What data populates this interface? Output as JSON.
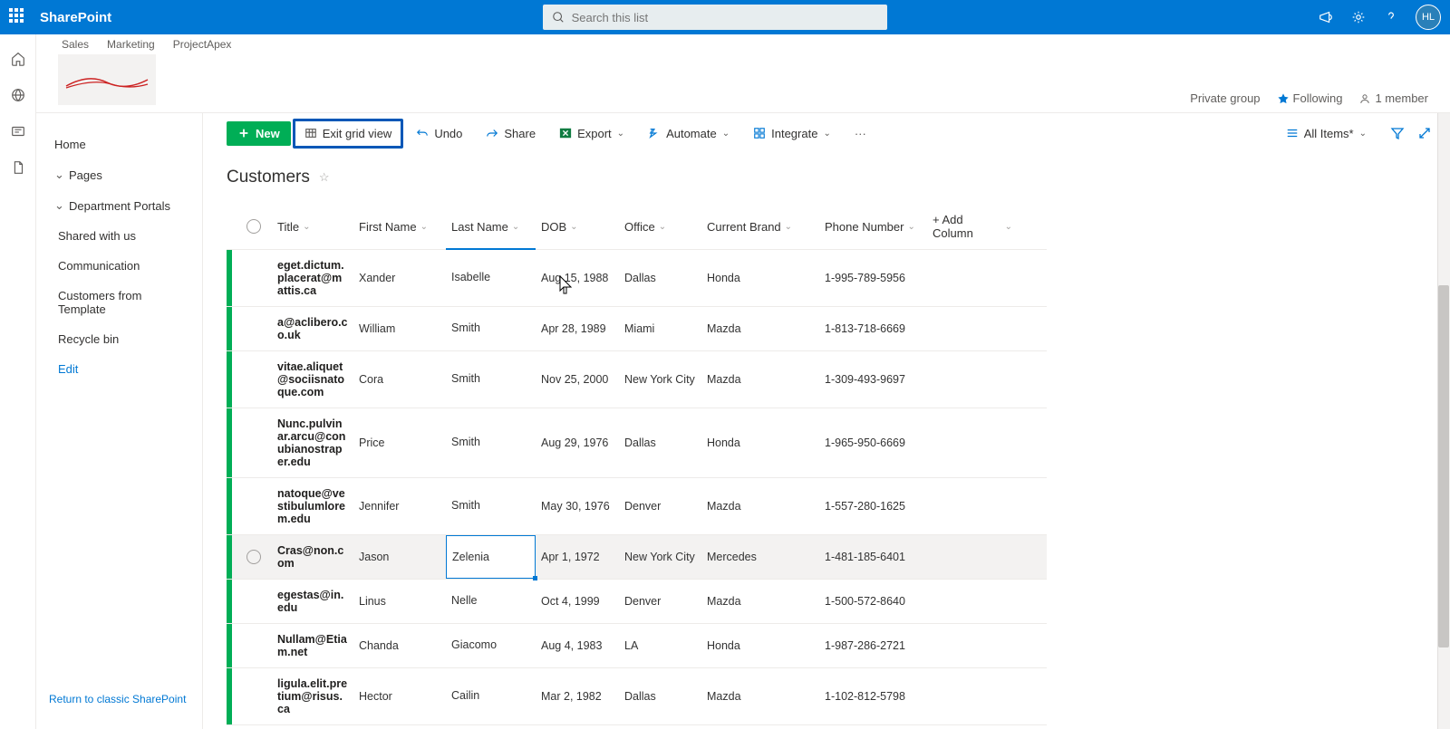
{
  "suite": {
    "brand": "SharePoint",
    "search_placeholder": "Search this list",
    "avatar": "HL"
  },
  "hub_nav": [
    "Sales",
    "Marketing",
    "ProjectApex"
  ],
  "site_right": {
    "group": "Private group",
    "following": "Following",
    "members": "1 member"
  },
  "left_nav": {
    "home": "Home",
    "pages": "Pages",
    "dept": "Department Portals",
    "shared": "Shared with us",
    "comm": "Communication",
    "cust": "Customers from Template",
    "recycle": "Recycle bin",
    "edit": "Edit",
    "return": "Return to classic SharePoint"
  },
  "cmd": {
    "new": "New",
    "exit": "Exit grid view",
    "undo": "Undo",
    "share": "Share",
    "export": "Export",
    "automate": "Automate",
    "integrate": "Integrate",
    "view": "All Items*"
  },
  "list": {
    "title": "Customers"
  },
  "columns": {
    "title": "Title",
    "first": "First Name",
    "last": "Last Name",
    "dob": "DOB",
    "office": "Office",
    "brand": "Current Brand",
    "phone": "Phone Number",
    "add": "+ Add Column"
  },
  "rows": [
    {
      "title": "eget.dictum.placerat@mattis.ca",
      "first": "Xander",
      "last": "Isabelle",
      "dob": "Aug 15, 1988",
      "office": "Dallas",
      "brand": "Honda",
      "phone": "1-995-789-5956"
    },
    {
      "title": "a@aclibero.co.uk",
      "first": "William",
      "last": "Smith",
      "dob": "Apr 28, 1989",
      "office": "Miami",
      "brand": "Mazda",
      "phone": "1-813-718-6669"
    },
    {
      "title": "vitae.aliquet@sociisnatoque.com",
      "first": "Cora",
      "last": "Smith",
      "dob": "Nov 25, 2000",
      "office": "New York City",
      "brand": "Mazda",
      "phone": "1-309-493-9697"
    },
    {
      "title": "Nunc.pulvinar.arcu@conubianostraper.edu",
      "first": "Price",
      "last": "Smith",
      "dob": "Aug 29, 1976",
      "office": "Dallas",
      "brand": "Honda",
      "phone": "1-965-950-6669"
    },
    {
      "title": "natoque@vestibulumlorem.edu",
      "first": "Jennifer",
      "last": "Smith",
      "dob": "May 30, 1976",
      "office": "Denver",
      "brand": "Mazda",
      "phone": "1-557-280-1625"
    },
    {
      "title": "Cras@non.com",
      "first": "Jason",
      "last": "Zelenia",
      "dob": "Apr 1, 1972",
      "office": "New York City",
      "brand": "Mercedes",
      "phone": "1-481-185-6401",
      "editing": true,
      "hover": true
    },
    {
      "title": "egestas@in.edu",
      "first": "Linus",
      "last": "Nelle",
      "dob": "Oct 4, 1999",
      "office": "Denver",
      "brand": "Mazda",
      "phone": "1-500-572-8640"
    },
    {
      "title": "Nullam@Etiam.net",
      "first": "Chanda",
      "last": "Giacomo",
      "dob": "Aug 4, 1983",
      "office": "LA",
      "brand": "Honda",
      "phone": "1-987-286-2721"
    },
    {
      "title": "ligula.elit.pretium@risus.ca",
      "first": "Hector",
      "last": "Cailin",
      "dob": "Mar 2, 1982",
      "office": "Dallas",
      "brand": "Mazda",
      "phone": "1-102-812-5798"
    }
  ]
}
